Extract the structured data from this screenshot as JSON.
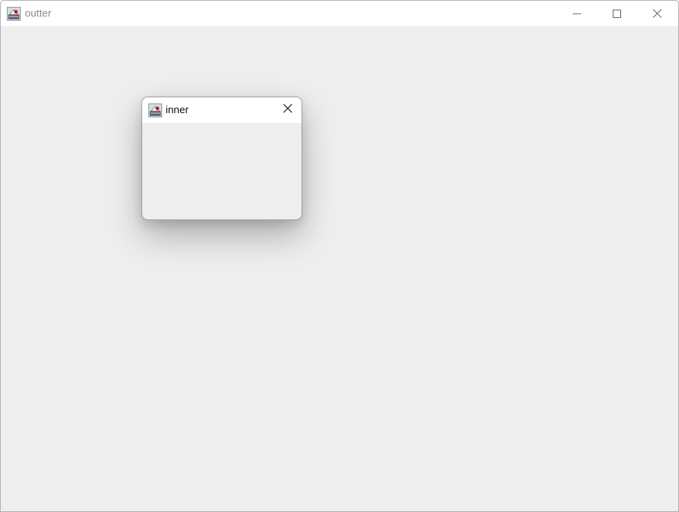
{
  "outer_window": {
    "title": "outter",
    "icon": "java-coffee-cup-icon",
    "controls": [
      "minimize-icon",
      "maximize-icon",
      "close-icon"
    ]
  },
  "inner_window": {
    "title": "inner",
    "icon": "java-coffee-cup-icon",
    "controls": [
      "close-icon"
    ]
  },
  "colors": {
    "client_background": "#eeeeee",
    "titlebar_background": "#ffffff",
    "inactive_title_text": "#8a8a8a",
    "active_title_text": "#111111"
  }
}
